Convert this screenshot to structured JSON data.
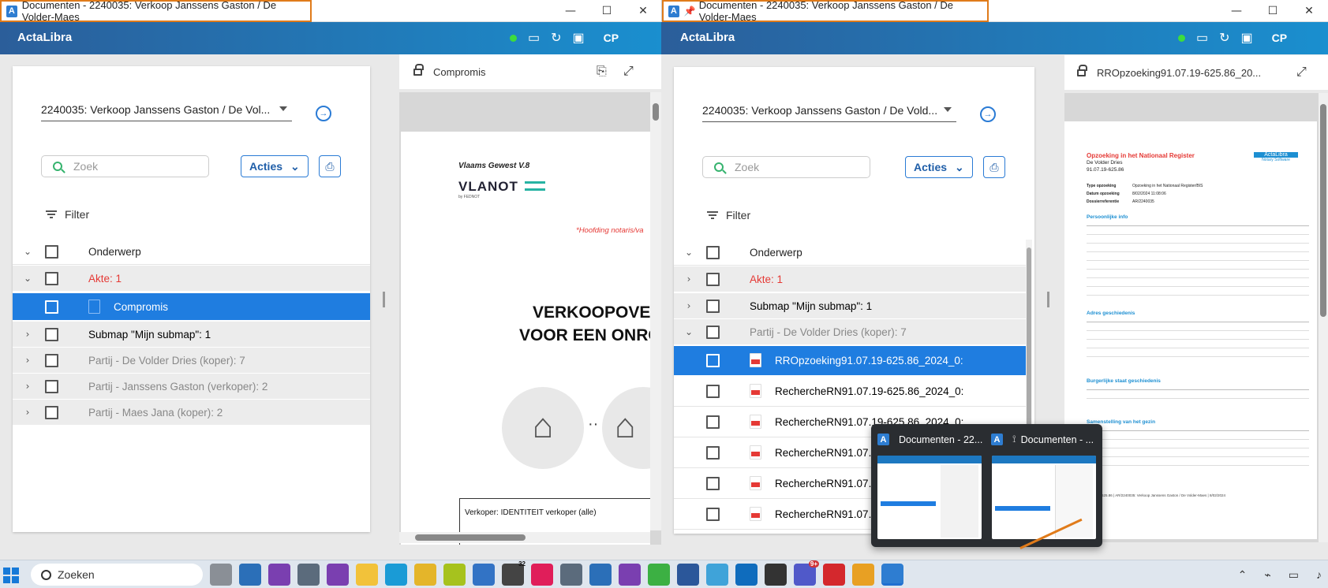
{
  "left_window": {
    "title": "Documenten - 2240035: Verkoop Janssens Gaston / De Volder-Maes",
    "app_name": "ActaLibra",
    "user_initials": "CP",
    "dossier_select": "2240035: Verkoop Janssens Gaston / De Vol...",
    "search_placeholder": "Zoek",
    "acties_label": "Acties",
    "filter_label": "Filter",
    "column_header": "Onderwerp",
    "rows": [
      {
        "label": "Akte: 1",
        "expand": "⌄"
      },
      {
        "label": "Compromis"
      },
      {
        "label": "Submap \"Mijn submap\": 1",
        "expand": "›"
      },
      {
        "label": "Partij - De Volder Dries (koper): 7",
        "expand": "›"
      },
      {
        "label": "Partij - Janssens Gaston (verkoper): 2",
        "expand": "›"
      },
      {
        "label": "Partij - Maes Jana (koper): 2",
        "expand": "›"
      }
    ],
    "viewer_title": "Compromis",
    "doc": {
      "header": "Vlaams Gewest V.8",
      "logo": "VLANOT",
      "logo_sub": "by FEDNOT",
      "notary_note": "*Hoofding notaris/va",
      "title_line1": "VERKOOPOVER",
      "title_line2": "VOOR EEN ONRO",
      "verkoper_line": "Verkoper:  IDENTITEIT verkoper (alle)"
    }
  },
  "right_window": {
    "title": "Documenten - 2240035: Verkoop Janssens Gaston / De Volder-Maes",
    "app_name": "ActaLibra",
    "user_initials": "CP",
    "dossier_select": "2240035: Verkoop Janssens Gaston / De Vold...",
    "search_placeholder": "Zoek",
    "acties_label": "Acties",
    "filter_label": "Filter",
    "column_header": "Onderwerp",
    "rows": [
      {
        "label": "Akte: 1",
        "expand": "›"
      },
      {
        "label": "Submap \"Mijn submap\": 1",
        "expand": "›"
      },
      {
        "label": "Partij - De Volder Dries (koper): 7",
        "expand": "⌄"
      },
      {
        "label": "RROpzoeking91.07.19-625.86_2024_0:"
      },
      {
        "label": "RechercheRN91.07.19-625.86_2024_0:"
      },
      {
        "label": "RechercheRN91.07.19-625.86_2024_0:"
      },
      {
        "label": "RechercheRN91.07.1"
      },
      {
        "label": "RechercheRN91.07.1"
      },
      {
        "label": "RechercheRN91.07.1"
      }
    ],
    "viewer_title": "RROpzoeking91.07.19-625.86_20...",
    "doc": {
      "title": "Opzoeking in het Nationaal Register",
      "name": "De Volder Dries",
      "nr": "91.07.19-625.86",
      "brand": "ActaLibra",
      "brand_sub": "Notary Software",
      "type_label": "Type opzoeking",
      "type_value": "Opzoeking in het Nationaal Register/BIS",
      "date_label": "Datum opzoeking",
      "date_value": "8/02/2024 11:08:06",
      "ref_label": "Dossierreferentie",
      "ref_value": "AR/2240035",
      "sec_personal": "Persoonlijke info",
      "sec_address": "Adres geschiedenis",
      "sec_civil": "Burgerlijke staat geschiedenis",
      "sec_family": "Samenstelling van het gezin",
      "footer": "91.07.19-625.86 | AR/2240035: Verkoop Janssens Gaston / De Volder-Maes | 8/02/2024"
    }
  },
  "popup": {
    "thumb1_title": "Documenten - 22...",
    "thumb2_title": "Documenten - ..."
  },
  "taskbar": {
    "search_label": "Zoeken",
    "notif_badge": "9+",
    "cx_badge": "32"
  }
}
